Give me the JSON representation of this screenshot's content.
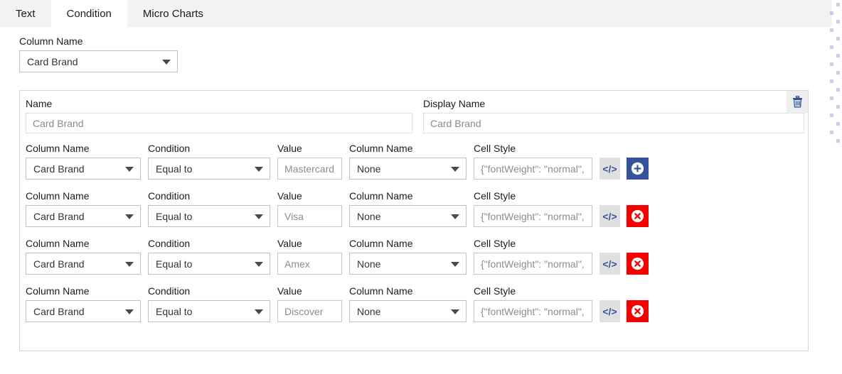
{
  "tabs": [
    {
      "label": "Text",
      "active": false
    },
    {
      "label": "Condition",
      "active": true
    },
    {
      "label": "Micro Charts",
      "active": false
    }
  ],
  "top_field": {
    "label": "Column Name",
    "value": "Card Brand"
  },
  "panel": {
    "name": {
      "label": "Name",
      "value": "Card Brand"
    },
    "display_name": {
      "label": "Display Name",
      "value": "Card Brand"
    },
    "delete_icon": "trash-icon",
    "labels": {
      "column_name": "Column Name",
      "condition": "Condition",
      "value": "Value",
      "column_name_2": "Column Name",
      "cell_style": "Cell Style"
    },
    "code_button_label": "</>",
    "add_button_label": "+",
    "remove_button_label": "×",
    "rows": [
      {
        "column_name": "Card Brand",
        "condition": "Equal to",
        "value": "Mastercard",
        "column_name_2": "None",
        "cell_style": "{\"fontWeight\": \"normal\",",
        "action": "add"
      },
      {
        "column_name": "Card Brand",
        "condition": "Equal to",
        "value": "Visa",
        "column_name_2": "None",
        "cell_style": "{\"fontWeight\": \"normal\",",
        "action": "remove"
      },
      {
        "column_name": "Card Brand",
        "condition": "Equal to",
        "value": "Amex",
        "column_name_2": "None",
        "cell_style": "{\"fontWeight\": \"normal\",",
        "action": "remove"
      },
      {
        "column_name": "Card Brand",
        "condition": "Equal to",
        "value": "Discover",
        "column_name_2": "None",
        "cell_style": "{\"fontWeight\": \"normal\",",
        "action": "remove"
      }
    ]
  },
  "colors": {
    "accent_blue": "#34539c",
    "danger_red": "#f90000",
    "tabbar_bg": "#f2f2f2",
    "border_gray": "#c4c8cc"
  }
}
